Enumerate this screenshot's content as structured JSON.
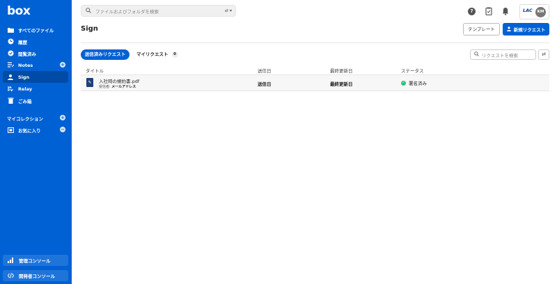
{
  "brand": {
    "logo": "box"
  },
  "sidebar": {
    "items": [
      {
        "label": "すべてのファイル",
        "icon": "folder-icon"
      },
      {
        "label": "履歴",
        "icon": "clock-icon"
      },
      {
        "label": "閲覧済み",
        "icon": "check-circle-icon"
      },
      {
        "label": "Notes",
        "icon": "notes-icon"
      },
      {
        "label": "Sign",
        "icon": "sign-icon"
      },
      {
        "label": "Relay",
        "icon": "relay-icon"
      },
      {
        "label": "ごみ箱",
        "icon": "trash-icon"
      }
    ],
    "collections_label": "マイコレクション",
    "favorites_label": "お気に入り",
    "admin_console": "管理コンソール",
    "dev_console": "開発者コンソール"
  },
  "search": {
    "placeholder": "ファイルおよびフォルダを検索"
  },
  "header": {
    "profile_org": "LAC",
    "avatar_initials": "KM"
  },
  "page": {
    "title": "Sign",
    "template_button": "テンプレート",
    "new_request_button": "新規リクエスト"
  },
  "tabs": {
    "sent": "送信済みリクエスト",
    "mine": "マイリクエスト",
    "mine_count": "0"
  },
  "request_search": {
    "placeholder": "リクエストを検索"
  },
  "table": {
    "columns": [
      "タイトル",
      "送信日",
      "最終更新日",
      "ステータス"
    ],
    "rows": [
      {
        "title": "入社時の規約書.pdf",
        "recipient_label": "受信者:",
        "recipient": "メールアドレス",
        "sent": "送信日",
        "updated": "最終更新日",
        "status": "署名済み"
      }
    ]
  },
  "colors": {
    "brand": "#0061d5",
    "status_signed": "#26c281"
  }
}
